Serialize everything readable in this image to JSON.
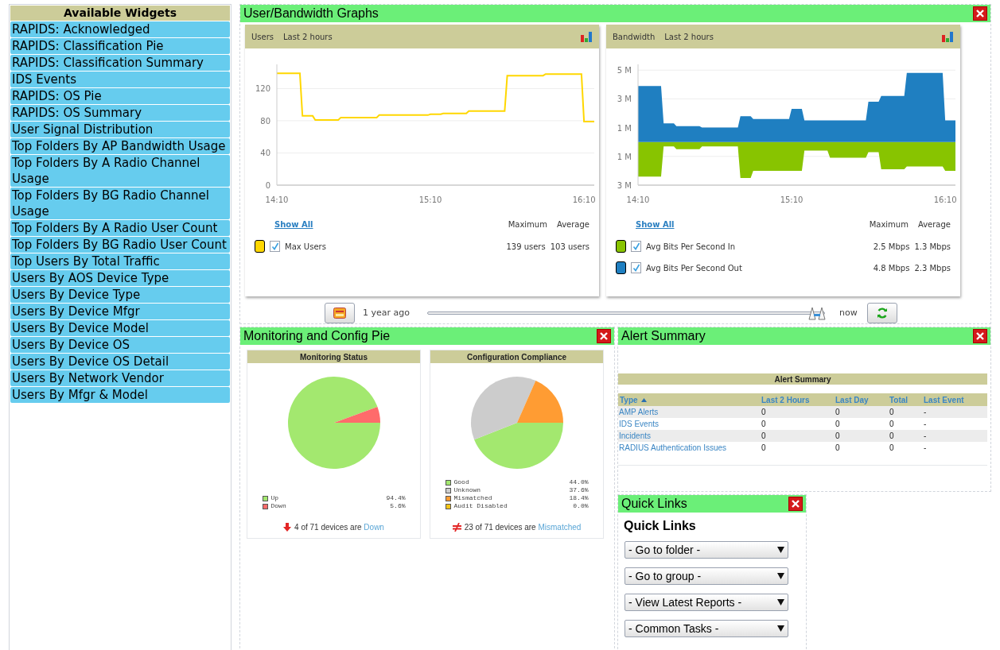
{
  "sidebar": {
    "title": "Available Widgets",
    "items": [
      "RAPIDS: Acknowledged",
      "RAPIDS: Classification Pie",
      "RAPIDS: Classification Summary",
      "IDS Events",
      "RAPIDS: OS Pie",
      "RAPIDS: OS Summary",
      "User Signal Distribution",
      "Top Folders By AP Bandwidth Usage",
      "Top Folders By A Radio Channel Usage",
      "Top Folders By BG Radio Channel Usage",
      "Top Folders By A Radio User Count",
      "Top Folders By BG Radio User Count",
      "Top Users By Total Traffic",
      "Users By AOS Device Type",
      "Users By Device Type",
      "Users By Device Mfgr",
      "Users By Device Model",
      "Users By Device OS",
      "Users By Device OS Detail",
      "Users By Network Vendor",
      "Users By Mfgr & Model"
    ]
  },
  "graphs_widget": {
    "title": "User/Bandwidth Graphs",
    "charts": [
      {
        "title": "Users",
        "period": "Last 2 hours",
        "show_all": "Show All",
        "columns": [
          "Maximum",
          "Average"
        ],
        "legend": [
          {
            "checked": true,
            "maximum": "139 users",
            "average": "103 users"
          }
        ],
        "chart_data": {
          "type": "line",
          "grid": true,
          "categories": [
            "14:10",
            null,
            null,
            null,
            null,
            null,
            null,
            null,
            null,
            null,
            null,
            null,
            null,
            null,
            null,
            null,
            null,
            null,
            null,
            null,
            null,
            null,
            null,
            null,
            null,
            null,
            null,
            null,
            null,
            null,
            null,
            null,
            null,
            null,
            null,
            null,
            null,
            null,
            null,
            null,
            null,
            null,
            null,
            null,
            null,
            null,
            null,
            null,
            null,
            null,
            null,
            null,
            null,
            null,
            null,
            null,
            null,
            null,
            null,
            null,
            "15:10",
            null,
            null,
            null,
            null,
            null,
            null,
            null,
            null,
            null,
            null,
            null,
            null,
            null,
            null,
            null,
            null,
            null,
            null,
            null,
            null,
            null,
            null,
            null,
            null,
            null,
            null,
            null,
            null,
            null,
            null,
            null,
            null,
            null,
            null,
            null,
            null,
            null,
            null,
            null,
            null,
            null,
            null,
            null,
            null,
            null,
            null,
            null,
            null,
            null,
            null,
            null,
            null,
            null,
            null,
            null,
            null,
            null,
            null,
            null,
            "16:10",
            null,
            null,
            null,
            null
          ],
          "ylim": [
            0,
            150
          ],
          "yticks": [
            0,
            40,
            80,
            120
          ],
          "series": [
            {
              "name": "Max Users",
              "color": "#ffd700",
              "values": [
                139,
                139,
                139,
                139,
                139,
                139,
                139,
                139,
                139,
                139,
                86,
                86,
                86,
                86,
                86,
                81,
                81,
                81,
                81,
                81,
                81,
                81,
                81,
                81,
                81,
                84,
                84,
                84,
                84,
                84,
                84,
                84,
                84,
                84,
                84,
                84,
                84,
                84,
                84,
                84,
                87,
                87,
                87,
                87,
                87,
                87,
                87,
                87,
                87,
                87,
                87,
                87,
                87,
                87,
                87,
                87,
                87,
                87,
                87,
                87,
                88,
                88,
                88,
                88,
                88,
                89,
                89,
                89,
                89,
                89,
                89,
                89,
                89,
                89,
                89,
                92,
                92,
                92,
                92,
                92,
                92,
                92,
                92,
                92,
                92,
                92,
                92,
                92,
                92,
                92,
                136,
                136,
                136,
                136,
                136,
                136,
                136,
                136,
                136,
                136,
                136,
                136,
                136,
                136,
                136,
                138,
                138,
                138,
                138,
                138,
                138,
                138,
                138,
                138,
                138,
                138,
                138,
                138,
                138,
                138,
                79,
                79,
                79,
                79,
                79
              ]
            }
          ]
        }
      },
      {
        "title": "Bandwidth",
        "period": "Last 2 hours",
        "show_all": "Show All",
        "columns": [
          "Maximum",
          "Average"
        ],
        "legend": [
          {
            "checked": true,
            "maximum": "2.5 Mbps",
            "average": "1.3 Mbps"
          },
          {
            "checked": true,
            "maximum": "4.8 Mbps",
            "average": "2.3 Mbps"
          }
        ],
        "chart_data": {
          "type": "area",
          "grid": true,
          "categories": [
            "14:10",
            null,
            null,
            null,
            null,
            null,
            null,
            null,
            null,
            null,
            null,
            null,
            null,
            null,
            null,
            null,
            null,
            null,
            null,
            null,
            null,
            null,
            null,
            null,
            null,
            null,
            null,
            null,
            null,
            null,
            null,
            null,
            null,
            null,
            null,
            null,
            null,
            null,
            null,
            null,
            null,
            null,
            null,
            null,
            null,
            null,
            null,
            null,
            null,
            null,
            null,
            null,
            null,
            null,
            null,
            null,
            null,
            null,
            null,
            null,
            "15:10",
            null,
            null,
            null,
            null,
            null,
            null,
            null,
            null,
            null,
            null,
            null,
            null,
            null,
            null,
            null,
            null,
            null,
            null,
            null,
            null,
            null,
            null,
            null,
            null,
            null,
            null,
            null,
            null,
            null,
            null,
            null,
            null,
            null,
            null,
            null,
            null,
            null,
            null,
            null,
            null,
            null,
            null,
            null,
            null,
            null,
            null,
            null,
            null,
            null,
            null,
            null,
            null,
            null,
            null,
            null,
            null,
            null,
            null,
            null,
            "16:10",
            null,
            null,
            null,
            null
          ],
          "ylim": [
            -3,
            5.4
          ],
          "yticks": [
            {
              "value": 5,
              "label": "5 M"
            },
            {
              "value": 3,
              "label": "3 M"
            },
            {
              "value": 1,
              "label": "1 M"
            },
            {
              "value": -1,
              "label": "1 M"
            },
            {
              "value": -3,
              "label": "3 M"
            }
          ],
          "series": [
            {
              "name": "Avg Bits Per Second In",
              "color": "#88c400",
              "values": [
                -2.4,
                -2.4,
                -2.4,
                -2.4,
                -2.4,
                -2.4,
                -2.4,
                -2.4,
                -2.4,
                -2.4,
                -0.3,
                -0.3,
                -0.3,
                -0.3,
                -0.3,
                -0.5,
                -0.5,
                -0.5,
                -0.5,
                -0.5,
                -0.5,
                -0.5,
                -0.5,
                -0.5,
                -0.5,
                -0.3,
                -0.3,
                -0.3,
                -0.3,
                -0.3,
                -0.3,
                -0.3,
                -0.3,
                -0.3,
                -0.3,
                -0.3,
                -0.3,
                -0.3,
                -0.3,
                -0.3,
                -2.5,
                -2.5,
                -2.5,
                -2.5,
                -2.5,
                -2,
                -2,
                -2,
                -2,
                -2,
                -2,
                -2,
                -2,
                -2,
                -2,
                -2,
                -2,
                -2,
                -2,
                -2,
                -2,
                -2,
                -2,
                -2,
                -2,
                -0.6,
                -0.6,
                -0.6,
                -0.6,
                -0.6,
                -0.6,
                -0.6,
                -0.6,
                -0.6,
                -0.6,
                -1.1,
                -1.1,
                -1.1,
                -1.1,
                -1.1,
                -1.1,
                -1.1,
                -1.1,
                -1.1,
                -1.1,
                -1.1,
                -1.1,
                -1.1,
                -1.1,
                -1.1,
                -0.7,
                -0.7,
                -0.7,
                -0.7,
                -0.7,
                -1.9,
                -1.9,
                -1.9,
                -1.9,
                -1.9,
                -1.9,
                -1.9,
                -1.9,
                -1.9,
                -1.9,
                -1.7,
                -1.7,
                -1.7,
                -1.7,
                -1.7,
                -1.7,
                -1.7,
                -1.7,
                -1.7,
                -1.7,
                -1.7,
                -1.7,
                -1.7,
                -1.7,
                -1.7,
                -2,
                -2,
                -2,
                -2,
                -2
              ]
            },
            {
              "name": "Avg Bits Per Second Out",
              "color": "#1f7fc1",
              "values": [
                3.9,
                3.9,
                3.9,
                3.9,
                3.9,
                3.9,
                3.9,
                3.9,
                3.9,
                3.9,
                1.3,
                1.3,
                1.3,
                1.3,
                1.3,
                1.1,
                1.1,
                1.1,
                1.1,
                1.1,
                1.1,
                1.1,
                1.1,
                1.1,
                1.1,
                1,
                1,
                1,
                1,
                1,
                1,
                1,
                1,
                1,
                1,
                1,
                1,
                1,
                1,
                1,
                1.8,
                1.8,
                1.8,
                1.8,
                1.8,
                1.6,
                1.6,
                1.6,
                1.6,
                1.6,
                1.6,
                1.6,
                1.6,
                1.6,
                1.6,
                1.6,
                1.6,
                1.6,
                1.6,
                1.6,
                2.3,
                2.3,
                2.3,
                2.3,
                2.3,
                1.5,
                1.5,
                1.5,
                1.5,
                1.5,
                1.5,
                1.5,
                1.5,
                1.5,
                1.5,
                1.5,
                1.5,
                1.5,
                1.5,
                1.5,
                1.5,
                1.5,
                1.5,
                1.5,
                1.5,
                1.5,
                1.5,
                1.5,
                1.5,
                1.5,
                2.8,
                2.8,
                2.8,
                2.8,
                2.8,
                3.2,
                3.2,
                3.2,
                3.2,
                3.2,
                3.2,
                3.2,
                3.2,
                3.2,
                3.2,
                4.8,
                4.8,
                4.8,
                4.8,
                4.8,
                4.8,
                4.8,
                4.8,
                4.8,
                4.8,
                4.8,
                4.8,
                4.8,
                4.8,
                4.8,
                1.5,
                1.5,
                1.5,
                1.5,
                1.5
              ]
            }
          ]
        }
      }
    ],
    "range": {
      "start": "1 year ago",
      "end": "now",
      "level": 0.98
    }
  },
  "pie_widget": {
    "title": "Monitoring and Config Pie",
    "pies": [
      {
        "title": "Monitoring Status",
        "legend": [
          {
            "value": "94.4%",
            "color": "#a3e86f"
          },
          {
            "value": "5.6%",
            "color": "#ff6b6b"
          }
        ],
        "chart_data": {
          "type": "pie",
          "categories": [
            "Up",
            "Down"
          ],
          "values": [
            94.4,
            5.6
          ]
        },
        "footer": {
          "kind": "down",
          "text": "4 of 71 devices are",
          "link": "Down"
        }
      },
      {
        "title": "Configuration Compliance",
        "legend": [
          {
            "value": "44.0%",
            "color": "#a3e86f"
          },
          {
            "value": "37.6%",
            "color": "#cccccc"
          },
          {
            "value": "18.4%",
            "color": "#ff9c33"
          },
          {
            "value": "0.0%",
            "color": "#f5c518"
          }
        ],
        "chart_data": {
          "type": "pie",
          "categories": [
            "Good",
            "Unknown",
            "Mismatched",
            "Audit Disabled"
          ],
          "values": [
            44.0,
            37.6,
            18.4,
            0.0
          ]
        },
        "footer": {
          "kind": "mismatch",
          "text": "23 of 71 devices are",
          "link": "Mismatched"
        }
      }
    ]
  },
  "alert_widget": {
    "title": "Alert Summary",
    "table": {
      "title": "Alert Summary",
      "columns": [
        {
          "label": "Type",
          "sorted": true
        },
        {
          "label": "Last 2 Hours",
          "sorted": false
        },
        {
          "label": "Last Day",
          "sorted": false
        },
        {
          "label": "Total",
          "sorted": false
        },
        {
          "label": "Last Event",
          "sorted": false
        }
      ],
      "rows": [
        [
          "AMP Alerts",
          "0",
          "0",
          "0",
          "-"
        ],
        [
          "IDS Events",
          "0",
          "0",
          "0",
          "-"
        ],
        [
          "Incidents",
          "0",
          "0",
          "0",
          "-"
        ],
        [
          "RADIUS Authentication Issues",
          "0",
          "0",
          "0",
          "-"
        ]
      ]
    }
  },
  "quick_links_widget": {
    "title": "Quick Links",
    "heading": "Quick Links",
    "selects": [
      "- Go to folder -",
      "- Go to group -",
      "- View Latest Reports -",
      "- Common Tasks -"
    ]
  }
}
